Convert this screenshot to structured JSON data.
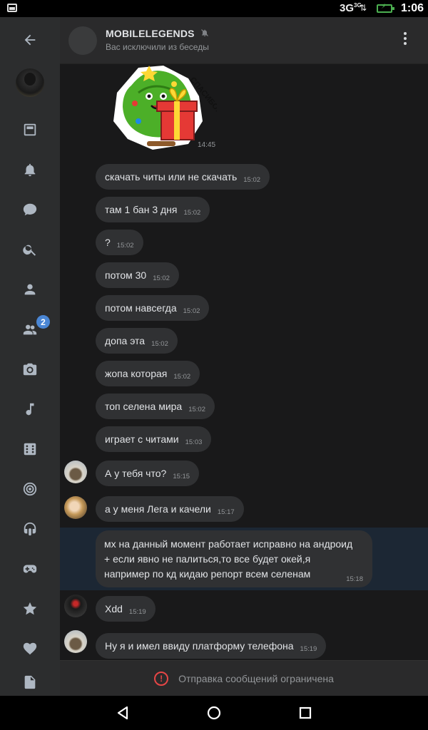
{
  "status_bar": {
    "network": "3G",
    "network_sup": "3G",
    "time": "1:06"
  },
  "sidebar": {
    "items": [
      {
        "icon": "back-arrow-icon"
      },
      {
        "icon": "user-avatar"
      },
      {
        "icon": "news-icon"
      },
      {
        "icon": "bell-icon"
      },
      {
        "icon": "message-icon"
      },
      {
        "icon": "search-icon"
      },
      {
        "icon": "profile-icon"
      },
      {
        "icon": "friends-icon",
        "badge": "2"
      },
      {
        "icon": "camera-icon"
      },
      {
        "icon": "music-icon"
      },
      {
        "icon": "apps-icon"
      },
      {
        "icon": "target-icon"
      },
      {
        "icon": "podcast-icon"
      },
      {
        "icon": "gamepad-icon"
      },
      {
        "icon": "star-icon"
      },
      {
        "icon": "heart-icon"
      },
      {
        "icon": "document-icon"
      }
    ]
  },
  "header": {
    "title": "MOBILELEGENDS",
    "subtitle": "Вас исключили из беседы"
  },
  "sticker": {
    "time": "14:45",
    "text": "СПАСИБО!"
  },
  "messages": [
    {
      "text": "скачать читы или не скачать",
      "time": "15:02"
    },
    {
      "text": "там 1 бан 3 дня",
      "time": "15:02"
    },
    {
      "text": "?",
      "time": "15:02"
    },
    {
      "text": "потом 30",
      "time": "15:02"
    },
    {
      "text": "потом навсегда",
      "time": "15:02"
    },
    {
      "text": "допа эта",
      "time": "15:02"
    },
    {
      "text": "жопа которая",
      "time": "15:02"
    },
    {
      "text": "топ селена мира",
      "time": "15:02"
    },
    {
      "text": "играет с читами",
      "time": "15:03"
    },
    {
      "text": "А у тебя что?",
      "time": "15:15"
    },
    {
      "text": "а у меня Лега и качели",
      "time": "15:17"
    },
    {
      "text": "мх на данный момент работает исправно на андроид\n+ если явно не палиться,то все будет окей,я\nнапример по кд кидаю репорт всем селенам",
      "time": "15:18"
    },
    {
      "text": "Xdd",
      "time": "15:19"
    },
    {
      "text": "Ну я и имел ввиду платформу телефона",
      "time": "15:19"
    }
  ],
  "footer": {
    "restriction_text": "Отправка сообщений ограничена"
  },
  "colors": {
    "background": "#19191a",
    "sidebar": "#2c2d2e",
    "bubble": "#303133",
    "accent": "#4a86d4",
    "warning": "#e64646"
  }
}
